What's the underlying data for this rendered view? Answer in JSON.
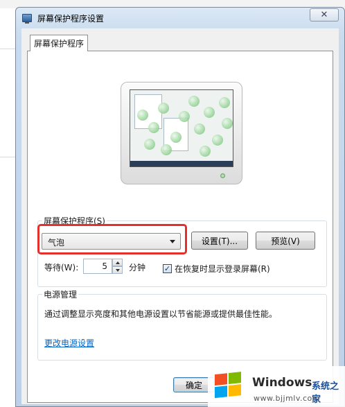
{
  "window": {
    "title": "屏幕保护程序设置",
    "close_symbol": "✕"
  },
  "tab": {
    "label": "屏幕保护程序"
  },
  "screensaver": {
    "group_label": "屏幕保护程序(S)",
    "selected": "气泡",
    "settings_button": "设置(T)...",
    "preview_button": "预览(V)",
    "wait_label": "等待(W):",
    "wait_value": "5",
    "wait_unit": "分钟",
    "resume_checked": true,
    "resume_check_symbol": "✓",
    "resume_label": "在恢复时显示登录屏幕(R)"
  },
  "power": {
    "group_label": "电源管理",
    "description": "通过调整显示亮度和其他电源设置以节省能源或提供最佳性能。",
    "link": "更改电源设置"
  },
  "footer": {
    "ok_button": "确定"
  },
  "watermark": {
    "brand": "Windows",
    "brand_cn": "系统之家",
    "url": "www.bjjmlv.com"
  },
  "colors": {
    "highlight": "#e3302a",
    "link": "#0066cc"
  }
}
